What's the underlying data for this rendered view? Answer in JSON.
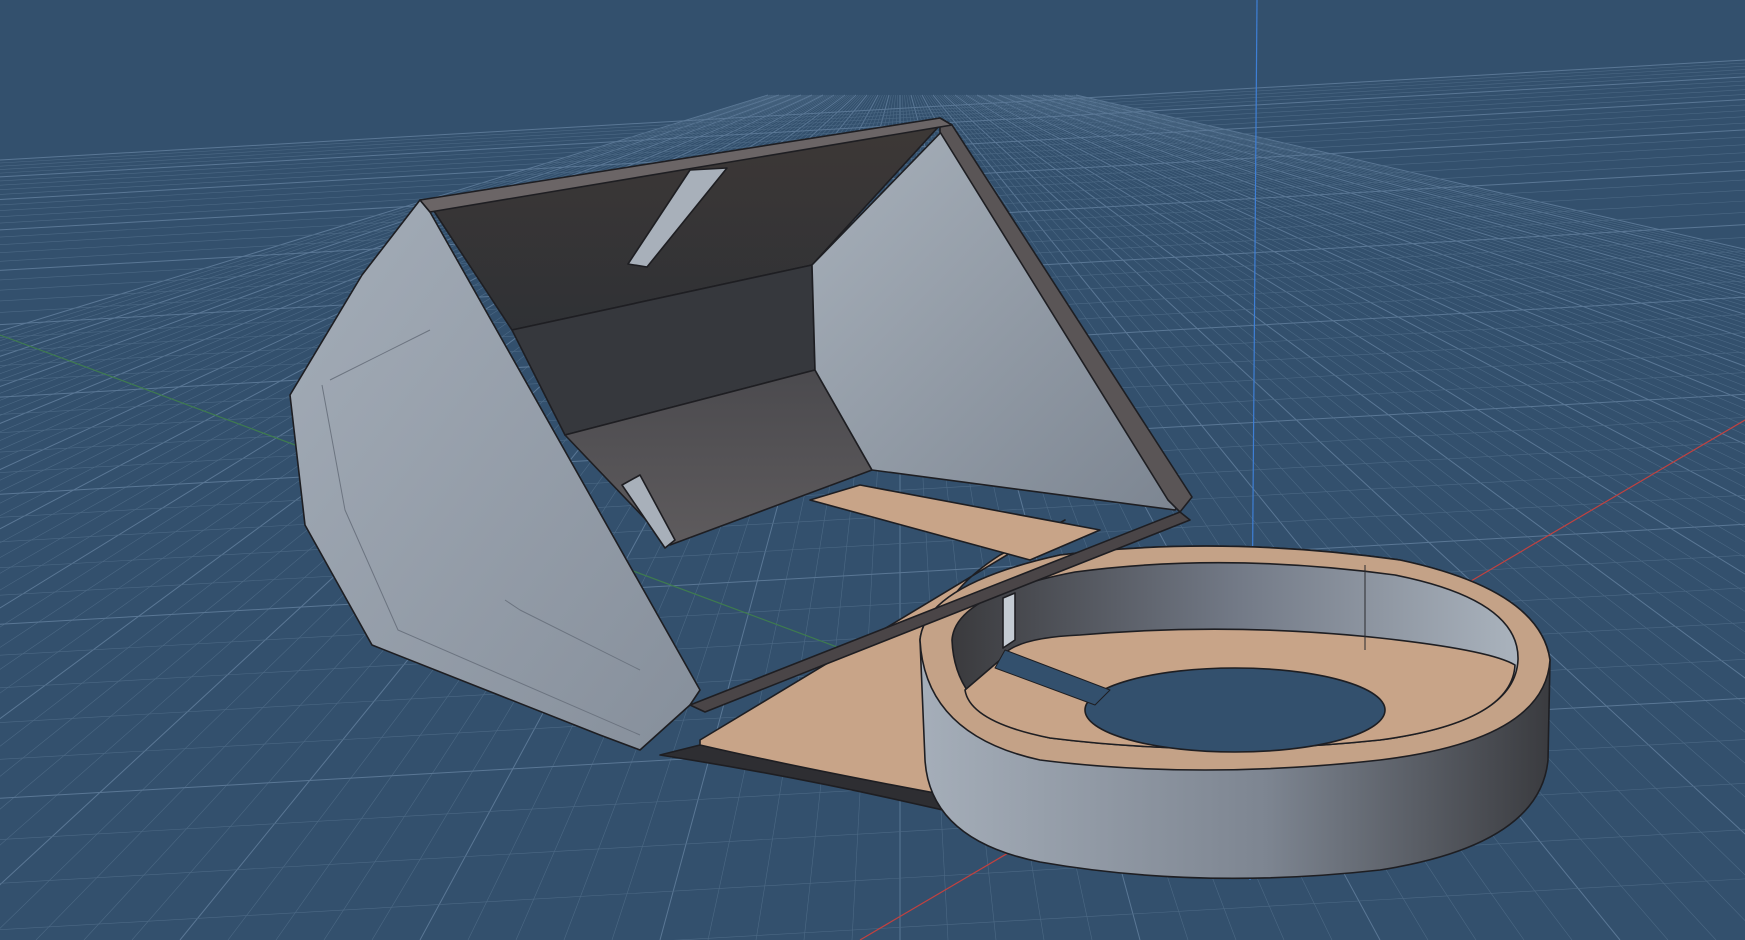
{
  "app": {
    "view": "3d-viewport",
    "projection": "perspective"
  },
  "scene": {
    "background_color": "#33506d",
    "grid": {
      "visible": true,
      "minor_line_color": "#4c6985",
      "major_line_color": "#5a7795"
    },
    "axes": {
      "x_axis_color": "#c2413f",
      "y_axis_color": "#3e7b4f",
      "z_axis_color": "#3e7fd6"
    },
    "model": {
      "description_icon": "cad-part-icon",
      "body_color": "#8f9aa8",
      "interior_color": "#3b3838",
      "selected_face_color": "#c8a488",
      "edge_color": "#1e1e22"
    }
  }
}
